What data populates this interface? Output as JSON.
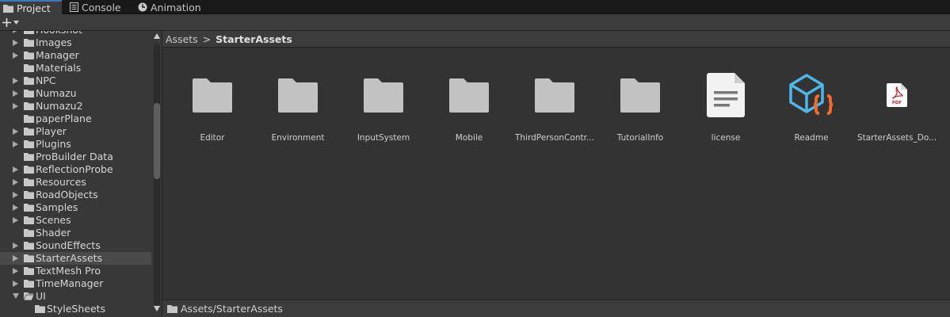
{
  "tabs": [
    {
      "label": "Project",
      "icon": "folder-icon"
    },
    {
      "label": "Console",
      "icon": "console-icon"
    },
    {
      "label": "Animation",
      "icon": "animation-icon"
    }
  ],
  "toolbar": {
    "create_symbol": "+",
    "create_dropdown": "▾"
  },
  "tree": {
    "items": [
      {
        "label": "Hookshot",
        "arrow": true
      },
      {
        "label": "Images",
        "arrow": true
      },
      {
        "label": "Manager",
        "arrow": true
      },
      {
        "label": "Materials",
        "arrow": false
      },
      {
        "label": "NPC",
        "arrow": true
      },
      {
        "label": "Numazu",
        "arrow": true
      },
      {
        "label": "Numazu2",
        "arrow": true
      },
      {
        "label": "paperPlane",
        "arrow": false
      },
      {
        "label": "Player",
        "arrow": true
      },
      {
        "label": "Plugins",
        "arrow": true
      },
      {
        "label": "ProBuilder Data",
        "arrow": false
      },
      {
        "label": "ReflectionProbe",
        "arrow": true
      },
      {
        "label": "Resources",
        "arrow": true
      },
      {
        "label": "RoadObjects",
        "arrow": true
      },
      {
        "label": "Samples",
        "arrow": true
      },
      {
        "label": "Scenes",
        "arrow": true
      },
      {
        "label": "Shader",
        "arrow": false
      },
      {
        "label": "SoundEffects",
        "arrow": true
      },
      {
        "label": "StarterAssets",
        "arrow": true,
        "selected": true
      },
      {
        "label": "TextMesh Pro",
        "arrow": true
      },
      {
        "label": "TimeManager",
        "arrow": true
      },
      {
        "label": "UI",
        "arrow": true,
        "expanded": true
      },
      {
        "label": "StyleSheets",
        "arrow": false,
        "child": true
      }
    ]
  },
  "breadcrumb": {
    "root": "Assets",
    "separator": ">",
    "current": "StarterAssets"
  },
  "assets": [
    {
      "name": "Editor",
      "type": "folder"
    },
    {
      "name": "Environment",
      "type": "folder"
    },
    {
      "name": "InputSystem",
      "type": "folder"
    },
    {
      "name": "Mobile",
      "type": "folder"
    },
    {
      "name": "ThirdPersonContr...",
      "type": "folder"
    },
    {
      "name": "TutorialInfo",
      "type": "folder"
    },
    {
      "name": "license",
      "type": "text"
    },
    {
      "name": "Readme",
      "type": "readme"
    },
    {
      "name": "StarterAssets_Do...",
      "type": "pdf"
    }
  ],
  "status": {
    "path": "Assets/StarterAssets"
  },
  "colors": {
    "accent": "#3a79bb",
    "folder": "#c2c2c2",
    "readme_blue": "#4fb6e8",
    "readme_orange": "#f06a2c",
    "pdf_red": "#d4242a"
  }
}
